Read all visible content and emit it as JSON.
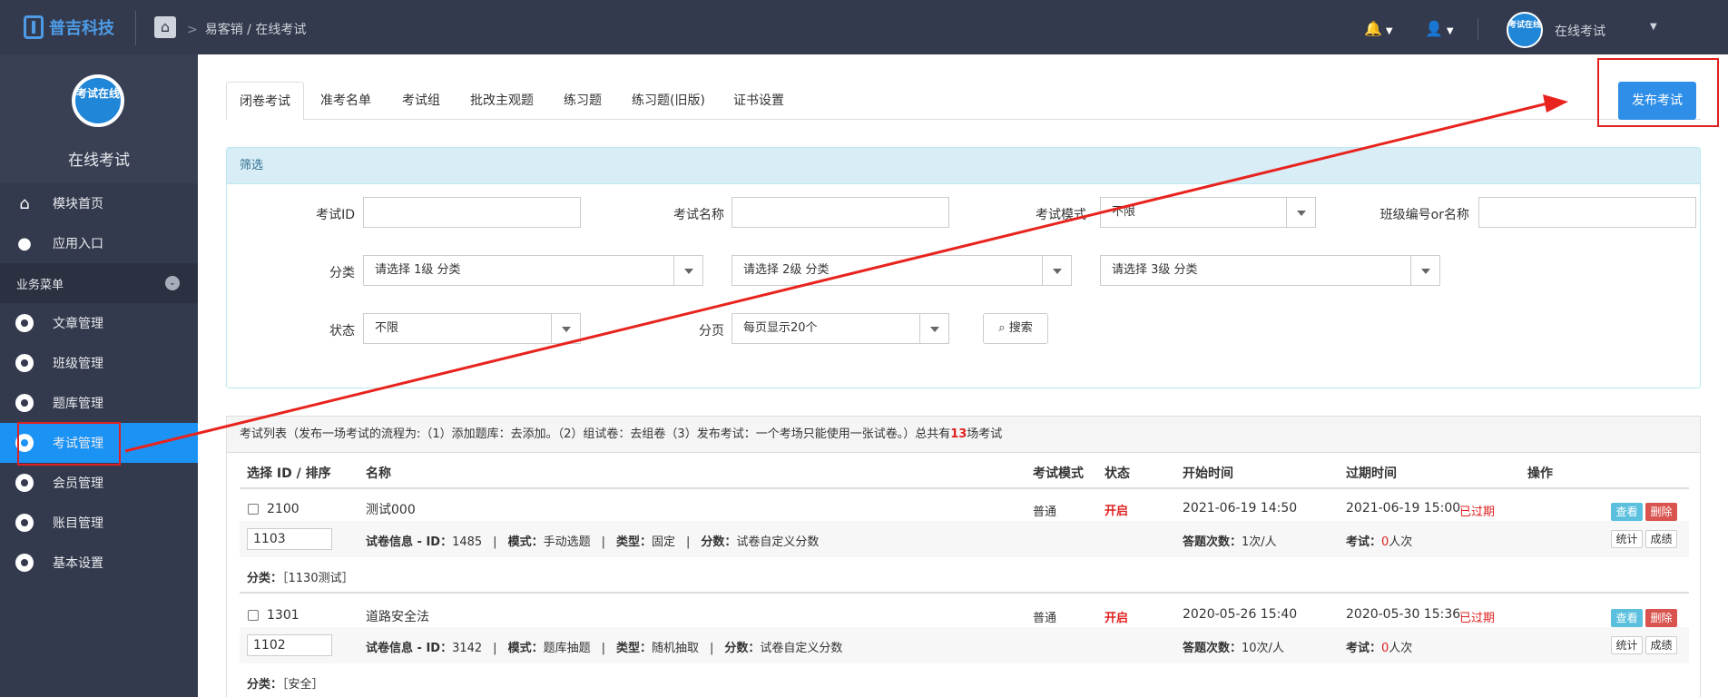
{
  "header": {
    "brand": "普吉科技",
    "breadcrumb": "易客销 / 在线考试",
    "user_avatar_text": "考试在线",
    "user_name": "在线考试"
  },
  "sidebar": {
    "logo_text": "考试在线",
    "title": "在线考试",
    "top_items": [
      {
        "label": "模块首页",
        "icon": "home-icon"
      },
      {
        "label": "应用入口",
        "icon": "chat-icon"
      }
    ],
    "section_label": "业务菜单",
    "items": [
      {
        "label": "文章管理",
        "icon": "gear-icon"
      },
      {
        "label": "班级管理",
        "icon": "gear-icon"
      },
      {
        "label": "题库管理",
        "icon": "gear-icon"
      },
      {
        "label": "考试管理",
        "icon": "gear-icon",
        "active": true
      },
      {
        "label": "会员管理",
        "icon": "gear-icon"
      },
      {
        "label": "账目管理",
        "icon": "gear-icon"
      },
      {
        "label": "基本设置",
        "icon": "gear-icon"
      }
    ]
  },
  "tabs": [
    "闭卷考试",
    "准考名单",
    "考试组",
    "批改主观题",
    "练习题",
    "练习题(旧版)",
    "证书设置"
  ],
  "publish_button": "发布考试",
  "filter": {
    "title": "筛选",
    "exam_id_label": "考试ID",
    "exam_name_label": "考试名称",
    "exam_mode_label": "考试模式",
    "exam_mode_value": "不限",
    "class_label": "班级编号or名称",
    "category_label": "分类",
    "cat1": "请选择 1级 分类",
    "cat2": "请选择 2级 分类",
    "cat3": "请选择 3级 分类",
    "status_label": "状态",
    "status_value": "不限",
    "paging_label": "分页",
    "paging_value": "每页显示20个",
    "search_label": "搜索"
  },
  "list": {
    "head_prefix": "考试列表（发布一场考试的流程为:（1）添加题库：去添加。（2）组试卷：去组卷（3）发布考试：一个考场只能使用一张试卷。）总共有",
    "count": "13",
    "head_suffix": "场考试",
    "columns": [
      "选择 ID / 排序",
      "名称",
      "考试模式",
      "状态",
      "开始时间",
      "过期时间",
      "操作"
    ],
    "rows": [
      {
        "id": "2100",
        "name": "测试000",
        "mode": "普通",
        "status": "开启",
        "start": "2021-06-19 14:50",
        "end": "2021-06-19 15:00",
        "expired": "已过期",
        "sort": "1103",
        "paper_id": "1485",
        "pick_mode": "手动选题",
        "type": "固定",
        "score": "试卷自定义分数",
        "attempts": "1次/人",
        "examined": "0",
        "category": "［1130测试］"
      },
      {
        "id": "1301",
        "name": "道路安全法",
        "mode": "普通",
        "status": "开启",
        "start": "2020-05-26 15:40",
        "end": "2020-05-30 15:36",
        "expired": "已过期",
        "sort": "1102",
        "paper_id": "3142",
        "pick_mode": "题库抽题",
        "type": "随机抽取",
        "score": "试卷自定义分数",
        "attempts": "10次/人",
        "examined": "0",
        "category": "［安全］"
      }
    ],
    "labels": {
      "paper_info": "试卷信息 - ID：",
      "mode": "模式：",
      "type": "类型：",
      "score": "分数：",
      "attempts": "答题次数：",
      "examined": "考试：",
      "people": "人次",
      "category": "分类：",
      "view": "查看",
      "delete": "删除",
      "stats": "统计",
      "grades": "成绩"
    }
  }
}
